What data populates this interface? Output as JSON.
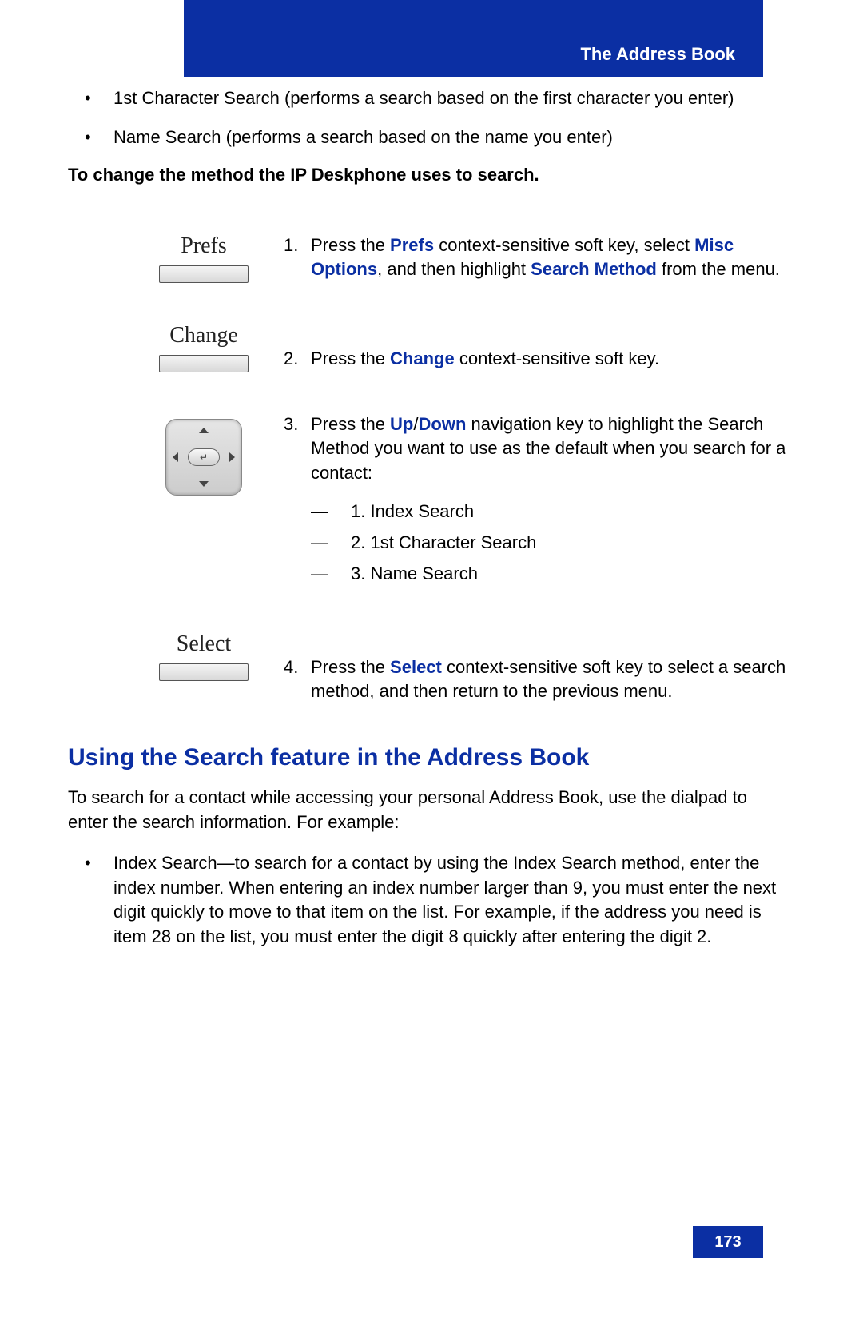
{
  "header": {
    "title": "The Address Book"
  },
  "intro_bullets": [
    "1st Character Search (performs a search based on the first character you enter)",
    "Name Search (performs a search based on the name you enter)"
  ],
  "instr_heading": "To change the method the IP Deskphone uses to search.",
  "steps": {
    "s1": {
      "softkey": "Prefs",
      "num": "1.",
      "text_pre": "Press the ",
      "hl1": "Prefs",
      "text_mid1": " context-sensitive soft key, select ",
      "hl2": "Misc Options",
      "text_mid2": ", and then highlight ",
      "hl3": "Search Method",
      "text_post": " from the menu."
    },
    "s2": {
      "softkey": "Change",
      "num": "2.",
      "text_pre": "Press the ",
      "hl1": "Change",
      "text_post": " context-sensitive soft key."
    },
    "s3": {
      "num": "3.",
      "text_pre": "Press the ",
      "hl1": "Up",
      "slash": "/",
      "hl2": "Down",
      "text_post": " navigation key to highlight the Search Method you want to use as the default when you search for a contact:",
      "subs": [
        "1. Index Search",
        "2. 1st Character Search",
        "3. Name Search"
      ]
    },
    "s4": {
      "softkey": "Select",
      "num": "4.",
      "text_pre": "Press the ",
      "hl1": "Select",
      "text_post": " context-sensitive soft key to select a search method, and then return to the previous menu."
    }
  },
  "section_heading": "Using the Search feature in the Address Book",
  "section_para": "To search for a contact while accessing your personal Address Book, use the dialpad to enter the search information. For example:",
  "section_bullet": "Index Search—to search for a contact by using the Index Search method, enter the index number. When entering an index number larger than 9, you must enter the next digit quickly to move to that item on the list. For example, if the address you need is item 28 on the list, you must enter the digit 8 quickly after entering the digit 2.",
  "page_number": "173"
}
